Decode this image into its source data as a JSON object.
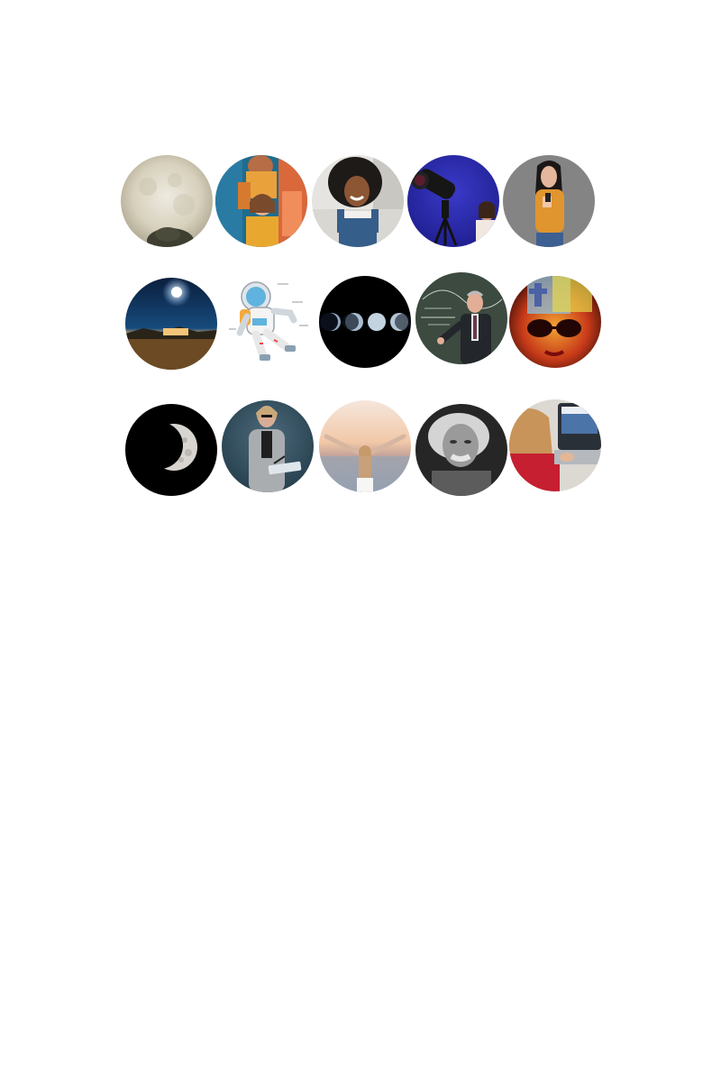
{
  "images": [
    {
      "subject": "full-moon-sky"
    },
    {
      "subject": "women-group-photo"
    },
    {
      "subject": "smiling-woman-curly-hair"
    },
    {
      "subject": "woman-with-telescope"
    },
    {
      "subject": "woman-using-phone"
    },
    {
      "subject": "night-sky-moon-landscape"
    },
    {
      "subject": "astronaut-illustration"
    },
    {
      "subject": "moon-phases"
    },
    {
      "subject": "professor-at-chalkboard"
    },
    {
      "subject": "woman-with-sunglasses"
    },
    {
      "subject": "crescent-moon"
    },
    {
      "subject": "teacher-with-notebook"
    },
    {
      "subject": "woman-arms-raised-sunset"
    },
    {
      "subject": "elderly-scientist-portrait"
    },
    {
      "subject": "woman-using-laptop"
    }
  ]
}
